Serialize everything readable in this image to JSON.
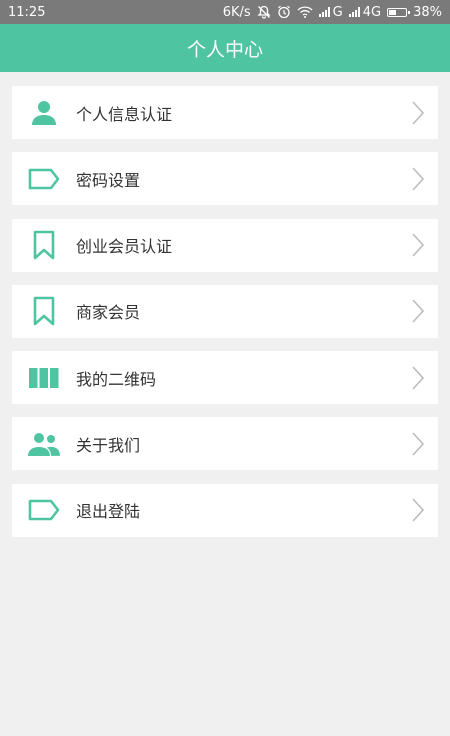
{
  "status_bar": {
    "time": "11:25",
    "speed": "6K/s",
    "signal_g": "G",
    "signal_4g": "4G",
    "battery": "38%",
    "battery_level": 0.38
  },
  "header": {
    "title": "个人中心"
  },
  "menu": {
    "items": [
      {
        "label": "个人信息认证",
        "icon": "person-icon"
      },
      {
        "label": "密码设置",
        "icon": "tag-icon"
      },
      {
        "label": "创业会员认证",
        "icon": "bookmark-icon"
      },
      {
        "label": "商家会员",
        "icon": "bookmark-icon"
      },
      {
        "label": "我的二维码",
        "icon": "qr-columns-icon"
      },
      {
        "label": "关于我们",
        "icon": "group-icon"
      },
      {
        "label": "退出登陆",
        "icon": "tag-icon"
      }
    ]
  },
  "colors": {
    "accent": "#4fc4a1",
    "status_bar": "#7a7a7a",
    "background": "#f0f0f0"
  }
}
